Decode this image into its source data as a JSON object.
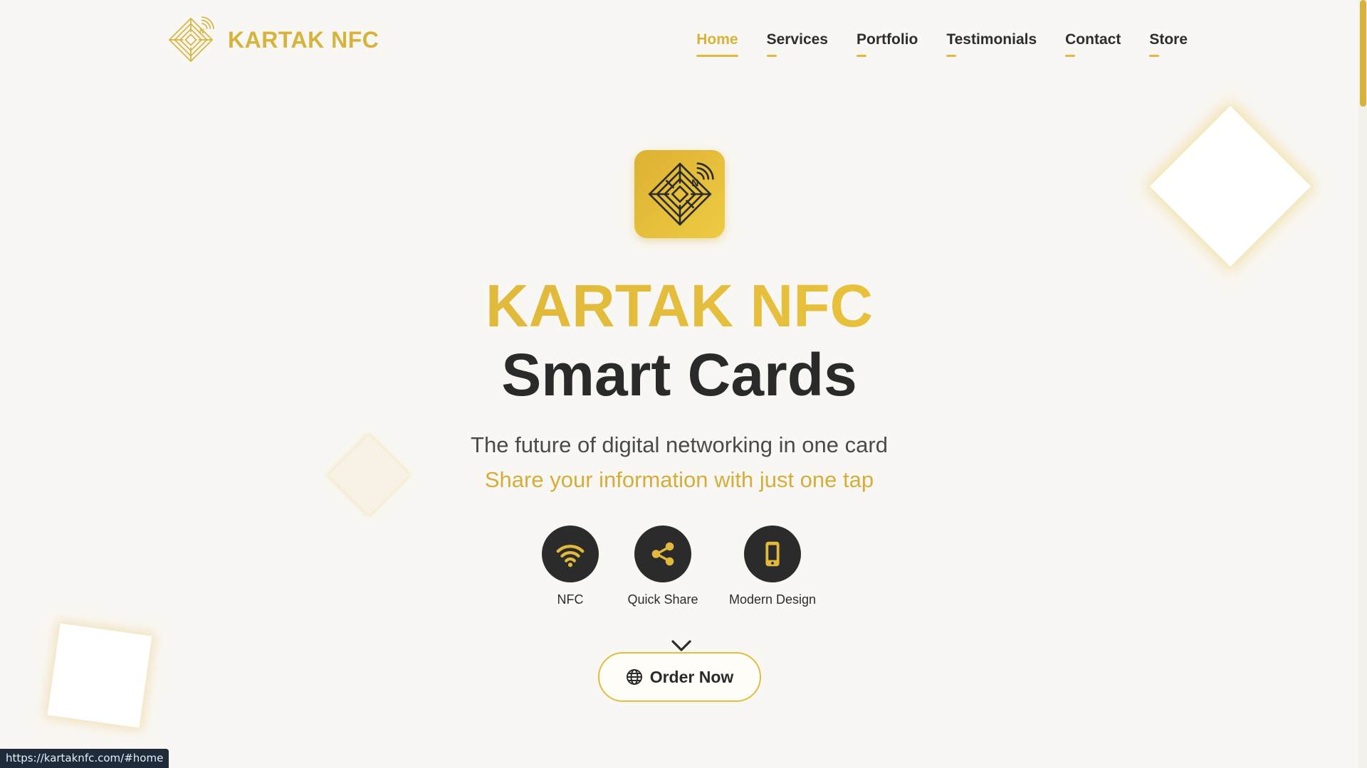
{
  "brand": {
    "name": "KARTAK NFC",
    "accent": "#d8b33c",
    "dark": "#2b2b2b",
    "background": "#f9f7f3"
  },
  "nav": {
    "items": [
      {
        "label": "Home",
        "active": true
      },
      {
        "label": "Services",
        "active": false
      },
      {
        "label": "Portfolio",
        "active": false
      },
      {
        "label": "Testimonials",
        "active": false
      },
      {
        "label": "Contact",
        "active": false
      },
      {
        "label": "Store",
        "active": false
      }
    ]
  },
  "hero": {
    "title": "KARTAK NFC",
    "subtitle": "Smart Cards",
    "tagline": "The future of digital networking in one card",
    "tagline_secondary": "Share your information with just one tap",
    "features": [
      {
        "label": "NFC",
        "icon": "wifi-icon"
      },
      {
        "label": "Quick Share",
        "icon": "share-icon"
      },
      {
        "label": "Modern Design",
        "icon": "mobile-icon"
      }
    ],
    "cta_label": "Order Now"
  },
  "status_bar": {
    "url": "https://kartaknfc.com/#home"
  }
}
